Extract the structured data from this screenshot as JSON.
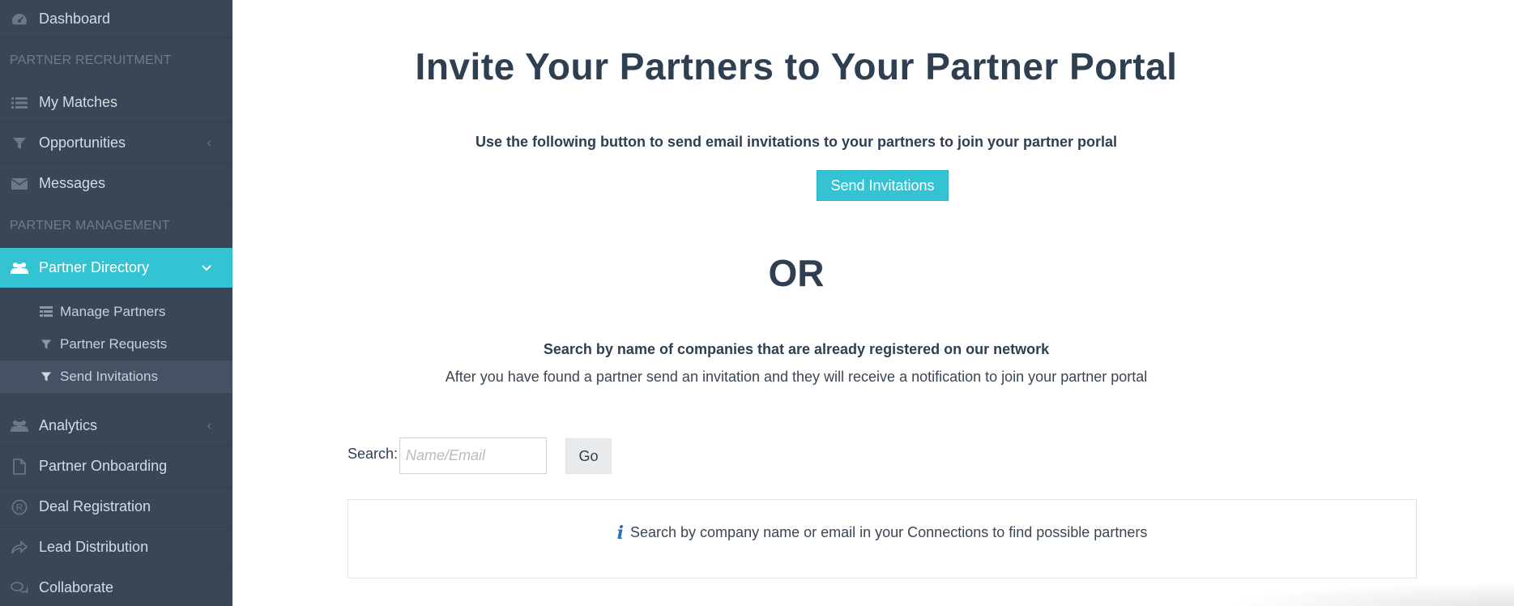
{
  "sidebar": {
    "dashboard": "Dashboard",
    "section_recruitment": "PARTNER RECRUITMENT",
    "my_matches": "My Matches",
    "opportunities": "Opportunities",
    "messages": "Messages",
    "section_management": "PARTNER MANAGEMENT",
    "partner_directory": "Partner Directory",
    "sub": {
      "manage_partners": "Manage Partners",
      "partner_requests": "Partner Requests",
      "send_invitations": "Send Invitations"
    },
    "analytics": "Analytics",
    "partner_onboarding": "Partner Onboarding",
    "deal_registration": "Deal Registration",
    "lead_distribution": "Lead Distribution",
    "collaborate": "Collaborate"
  },
  "main": {
    "title": "Invite Your Partners to Your Partner Portal",
    "subtitle": "Use the following button to send email invitations to your partners to join your partner porlal",
    "send_button": "Send Invitations",
    "or": "OR",
    "search_heading": "Search by name of companies that are already registered on our network",
    "search_desc": "After you have found a partner send an invitation and they will receive a notification to join your partner portal",
    "search_label": "Search:",
    "search_placeholder": "Name/Email",
    "go_button": "Go",
    "info_icon": "i",
    "info_text": "Search by company name or email in your Connections to find possible partners"
  },
  "colors": {
    "sidebar_bg": "#3a4655",
    "accent": "#34c3d3",
    "heading": "#2f3f52"
  }
}
